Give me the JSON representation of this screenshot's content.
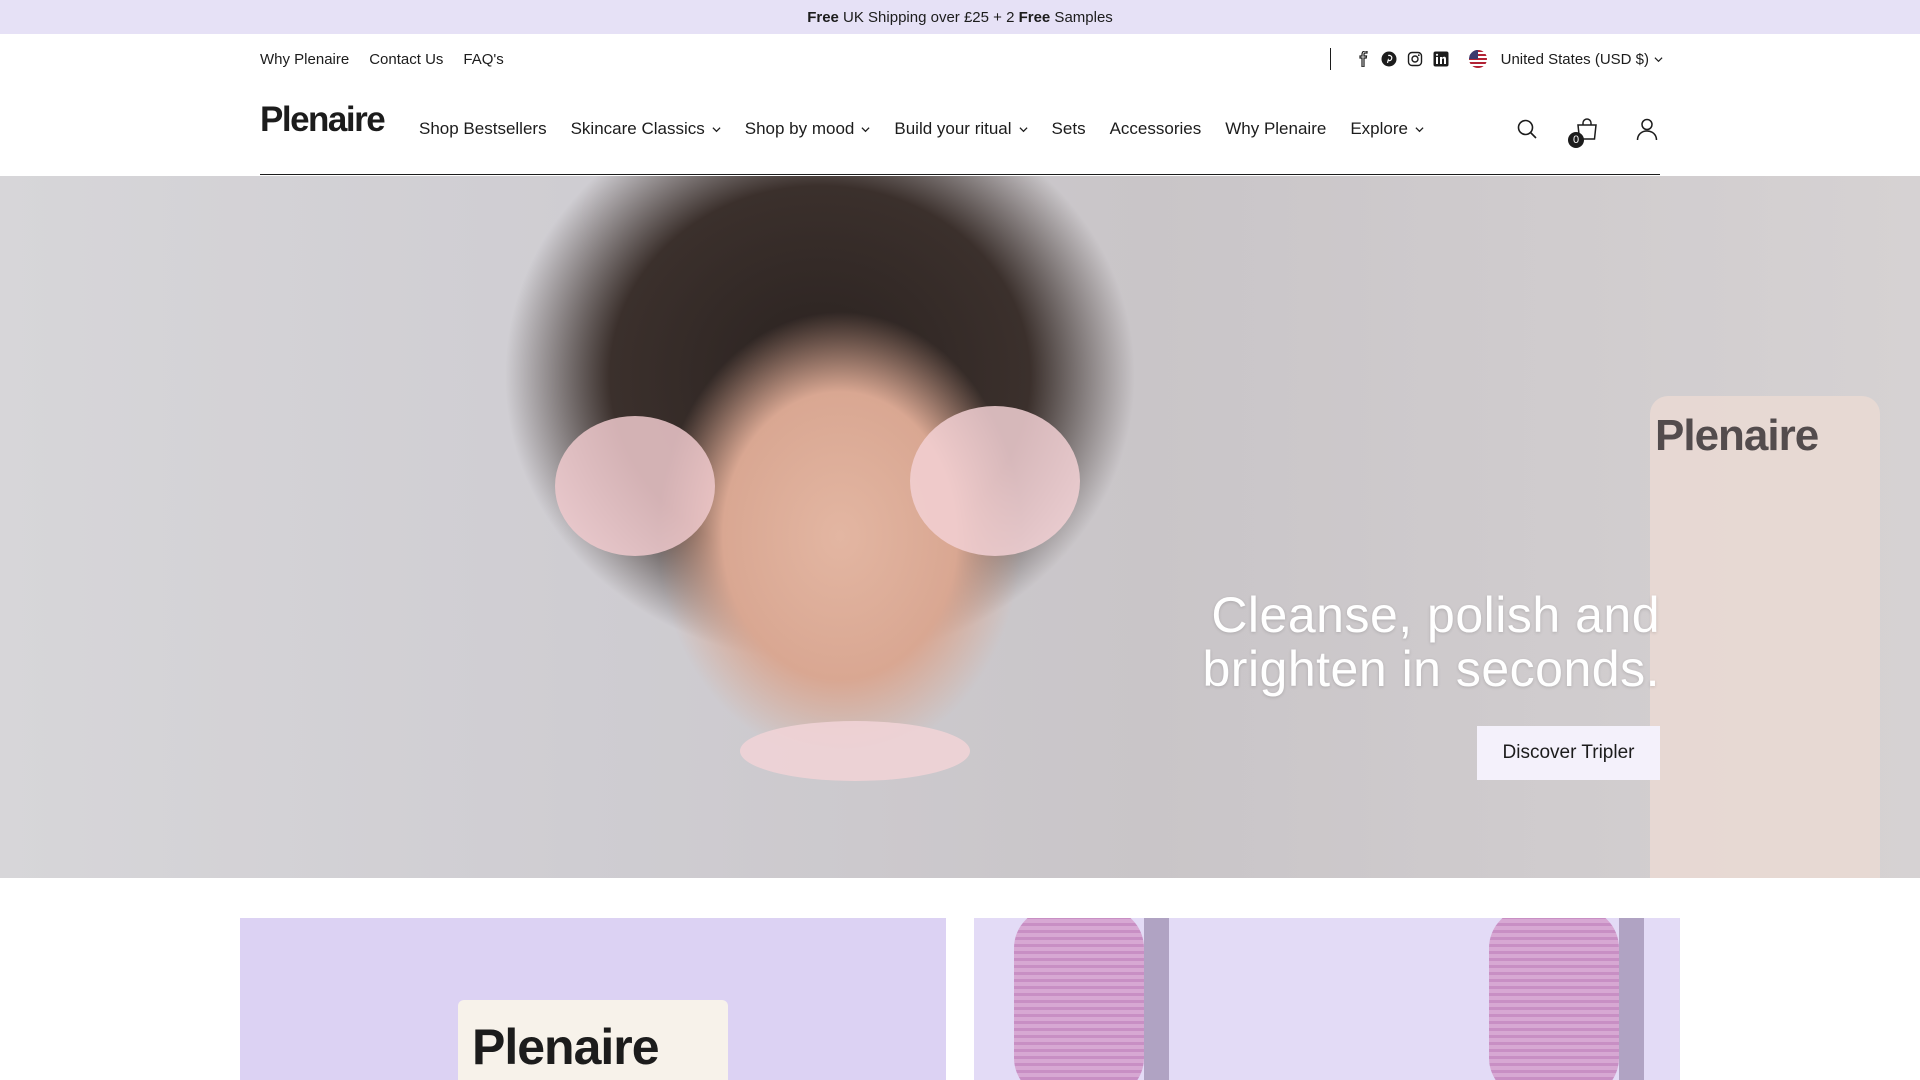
{
  "announcement": {
    "free1": "Free",
    "middle": " UK Shipping over £25 + 2 ",
    "free2": "Free",
    "end": " Samples"
  },
  "utility": {
    "links": [
      "Why Plenaire",
      "Contact Us",
      "FAQ's"
    ],
    "social": [
      "facebook-icon",
      "pinterest-icon",
      "instagram-icon",
      "linkedin-icon"
    ],
    "currency": "United States (USD $)"
  },
  "header": {
    "logo": "Plenaire",
    "menu": [
      {
        "label": "Shop Bestsellers",
        "dropdown": false
      },
      {
        "label": "Skincare Classics",
        "dropdown": true
      },
      {
        "label": "Shop by mood",
        "dropdown": true
      },
      {
        "label": "Build your ritual",
        "dropdown": true
      },
      {
        "label": "Sets",
        "dropdown": false
      },
      {
        "label": "Accessories",
        "dropdown": false
      },
      {
        "label": "Why Plenaire",
        "dropdown": false
      },
      {
        "label": "Explore",
        "dropdown": true
      }
    ],
    "cart_count": "0"
  },
  "hero": {
    "headline_line1": "Cleanse, polish and",
    "headline_line2": "brighten in seconds.",
    "cta": "Discover Tripler",
    "product_brand": "Plenaire"
  },
  "cards": {
    "left_product_brand": "Plenaire"
  }
}
